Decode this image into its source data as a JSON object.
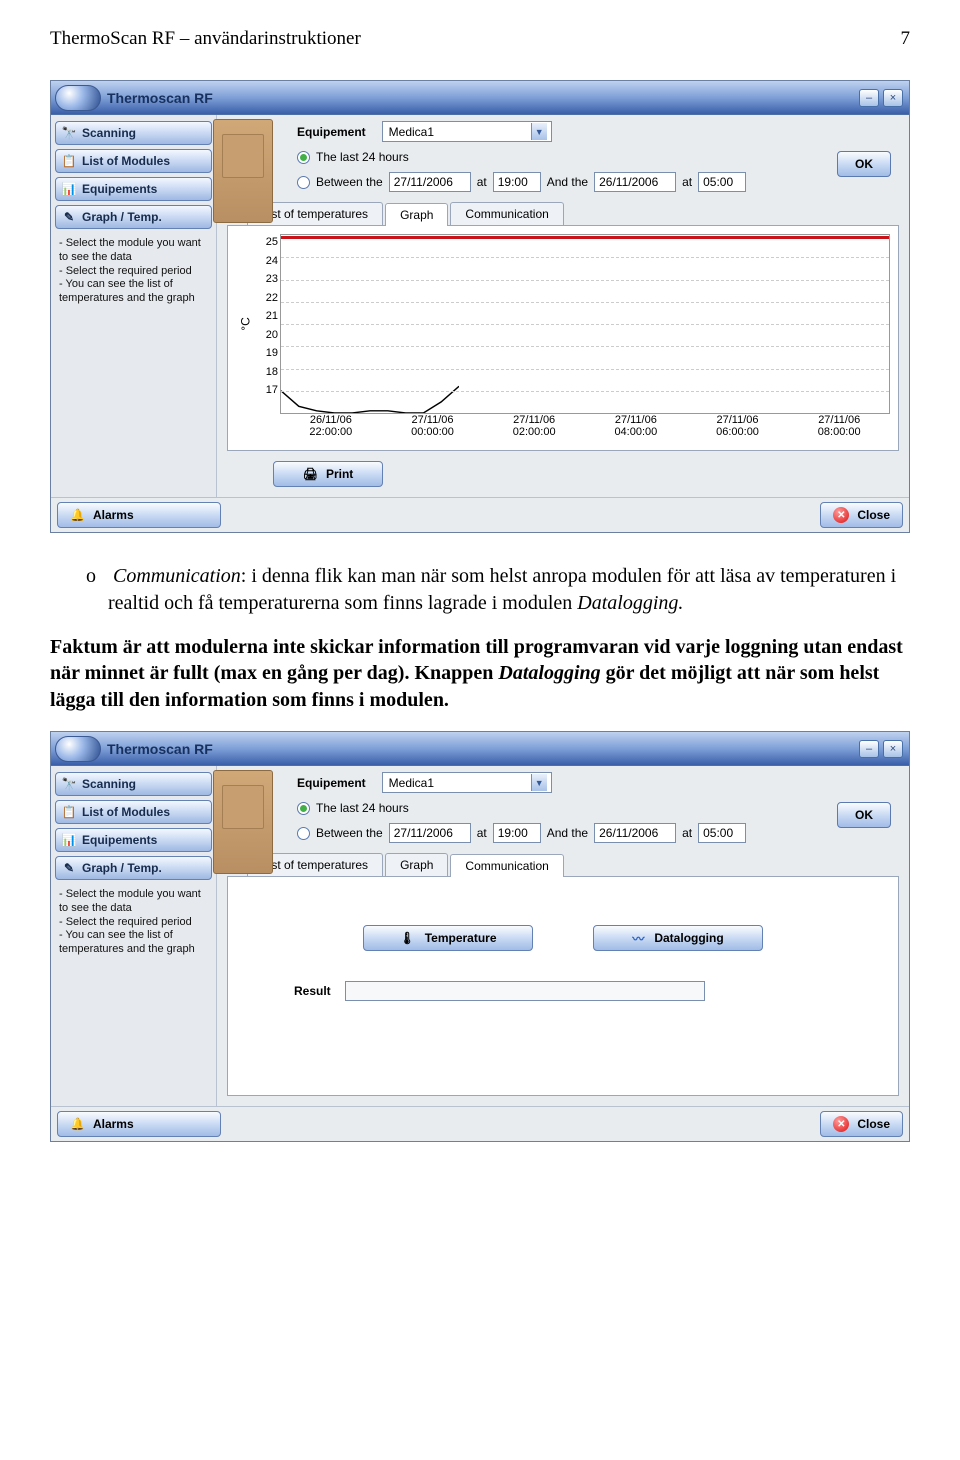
{
  "doc": {
    "header_left": "ThermoScan RF – användarinstruktioner",
    "page_no": "7"
  },
  "app": {
    "title": "Thermoscan RF",
    "sidebar": {
      "items": [
        {
          "label": "Scanning",
          "icon": "binoculars-icon"
        },
        {
          "label": "List of Modules",
          "icon": "list-icon"
        },
        {
          "label": "Equipements",
          "icon": "chart-icon"
        },
        {
          "label": "Graph / Temp.",
          "icon": "pencil-icon"
        }
      ],
      "help_text": "- Select the module you want to see the data\n- Select the required period\n- You can see the list of temperatures and the graph"
    },
    "equip": {
      "label": "Equipement",
      "value": "Medica1"
    },
    "radios": {
      "last24": "The last 24 hours",
      "between": "Between the",
      "and_the": "And the",
      "at": "at"
    },
    "dates": {
      "d1": "27/11/2006",
      "t1": "19:00",
      "d2": "26/11/2006",
      "t2": "05:00"
    },
    "ok": "OK",
    "tabs": {
      "list": "List of temperatures",
      "graph": "Graph",
      "comm": "Communication"
    },
    "print": "Print",
    "alarms": "Alarms",
    "close": "Close",
    "comm": {
      "temp_btn": "Temperature",
      "log_btn": "Datalogging",
      "result_label": "Result"
    }
  },
  "chart_data": {
    "type": "line",
    "ylabel": "°C",
    "ylim": [
      17,
      25
    ],
    "yticks": [
      "25",
      "24",
      "23",
      "22",
      "21",
      "20",
      "19",
      "18",
      "17"
    ],
    "x": [
      {
        "l1": "26/11/06",
        "l2": "22:00:00"
      },
      {
        "l1": "27/11/06",
        "l2": "00:00:00"
      },
      {
        "l1": "27/11/06",
        "l2": "02:00:00"
      },
      {
        "l1": "27/11/06",
        "l2": "04:00:00"
      },
      {
        "l1": "27/11/06",
        "l2": "06:00:00"
      },
      {
        "l1": "27/11/06",
        "l2": "08:00:00"
      }
    ],
    "series": [
      {
        "name": "upper-limit",
        "values": [
          25,
          25,
          25,
          25,
          25,
          25,
          25,
          25,
          25,
          25,
          25
        ]
      },
      {
        "name": "temperature",
        "values": [
          18.0,
          17.3,
          17.1,
          17.0,
          17.0,
          17.1,
          17.1,
          17.0,
          17.0,
          17.5,
          18.2
        ]
      }
    ]
  },
  "body_text": {
    "p1_prefix": "o",
    "p1_em": "Communication",
    "p1_rest": ": i denna flik kan man när som helst anropa modulen för att läsa av temperaturen i realtid och få temperaturerna som finns lagrade i modulen ",
    "p1_em2": "Datalogging.",
    "p2_a": "Faktum är att modulerna inte skickar information till programvaran vid varje loggning utan endast när minnet är fullt (max en gång per dag). Knappen ",
    "p2_em": "Datalogging",
    "p2_b": " gör det möjligt att när som helst lägga till den information som finns i modulen."
  }
}
